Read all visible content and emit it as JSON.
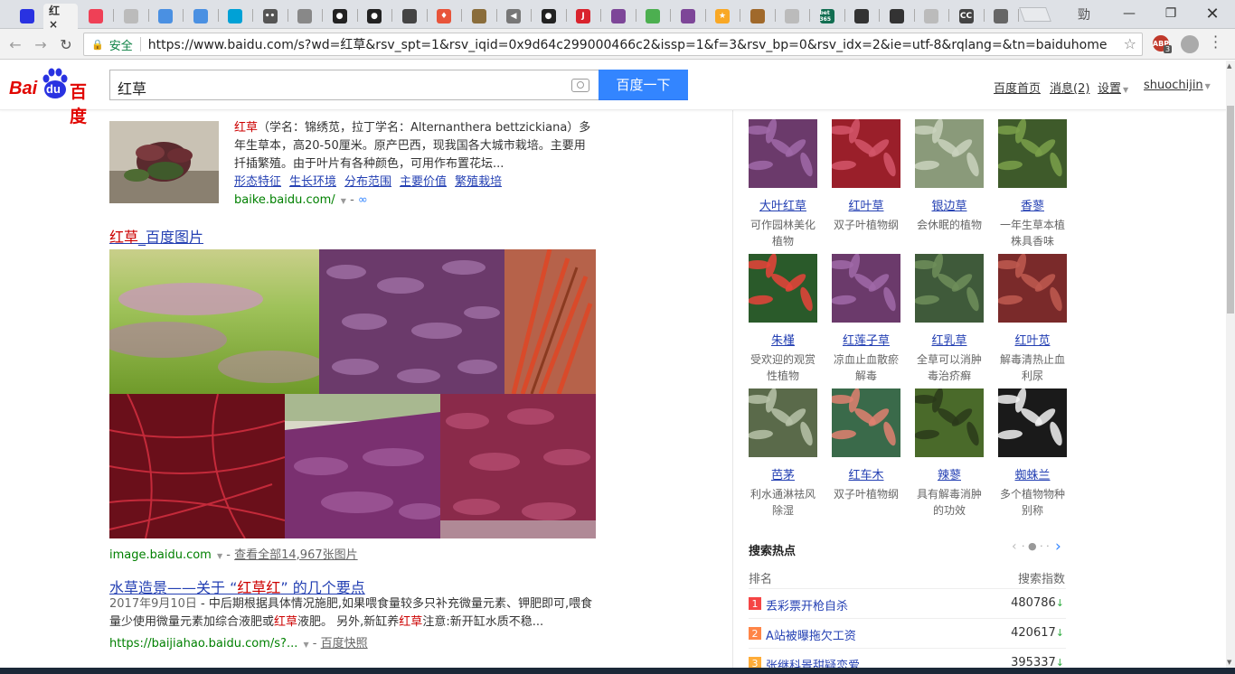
{
  "browser": {
    "secure_label": "安全",
    "url": "https://www.baidu.com/s?wd=红草&rsv_spt=1&rsv_iqid=0x9d64c299000466c2&issp=1&f=3&rsv_bp=0&rsv_idx=2&ie=utf-8&rqlang=&tn=baiduhome_pg&...",
    "active_tab_label": "红",
    "profile_glyph": "勁",
    "abp_label": "ABP",
    "abp_count": "3",
    "tab_icons": [
      "paw-icon",
      "close-icon",
      "pocket-icon",
      "page-icon",
      "rocket-icon",
      "rocket-icon",
      "bilibili-icon",
      "face-icon",
      "robot-icon",
      "github-icon",
      "github-icon",
      "code-icon",
      "fire-icon",
      "plane-icon",
      "media-icon",
      "github-icon",
      "j-icon",
      "tor-icon",
      "chrome-icon",
      "tor-icon",
      "star-icon",
      "lock-icon",
      "page-icon",
      "bet365-icon",
      "board-icon",
      "board-icon",
      "page-icon",
      "cc-icon",
      "browser-icon"
    ],
    "tab_texts": {
      "j-icon": "J",
      "bet365-icon": "bet 365",
      "cc-icon": "CC"
    }
  },
  "header": {
    "logo_bai": "Bai",
    "logo_du": "du",
    "logo_cn": "百度",
    "query": "红草",
    "search_button": "百度一下",
    "links": [
      "百度首页",
      "消息(2)",
      "设置",
      "shuochijin"
    ]
  },
  "results": {
    "baike": {
      "snippet_em": "红草",
      "snippet": "（学名：锦绣苋，拉丁学名：Alternanthera bettzickiana）多年生草本，高20-50厘米。原产巴西，现我国各大城市栽培。主要用扦插繁殖。由于叶片有各种颜色，可用作布置花坛...",
      "sublinks": [
        "形态特征",
        "生长环境",
        "分布范围",
        "主要价值",
        "繁殖栽培"
      ],
      "url": "baike.baidu.com/",
      "url_suffix": "-"
    },
    "images": {
      "title_em": "红草",
      "title_rest": "_百度图片",
      "url": "image.baidu.com",
      "more": "查看全部14,967张图片"
    },
    "article": {
      "title_a": "水草造景——关于 “",
      "title_em": "红草红",
      "title_b": "” 的几个要点",
      "date": "2017年9月10日",
      "snippet_a": " - 中后期根据具体情况施肥,如果喂食量较多只补充微量元素、钾肥即可,喂食量少使用微量元素加综合液肥或",
      "snippet_em1": "红草",
      "snippet_b": "液肥。 另外,新缸养",
      "snippet_em2": "红草",
      "snippet_c": "注意:新开缸水质不稳...",
      "url": "https://baijiahao.baidu.com/s?...",
      "cache": "百度快照"
    }
  },
  "related_plants": [
    {
      "name": "大叶红草",
      "desc": "可作园林美化植物"
    },
    {
      "name": "红叶草",
      "desc": "双子叶植物纲"
    },
    {
      "name": "银边草",
      "desc": "会休眠的植物"
    },
    {
      "name": "香蓼",
      "desc": "一年生草本植株具香味"
    },
    {
      "name": "朱槿",
      "desc": "受欢迎的观赏性植物"
    },
    {
      "name": "红莲子草",
      "desc": "凉血止血散瘀解毒"
    },
    {
      "name": "红乳草",
      "desc": "全草可以消肿毒治疥癣"
    },
    {
      "name": "红叶苋",
      "desc": "解毒清热止血利尿"
    },
    {
      "name": "芭茅",
      "desc": "利水通淋祛风除湿"
    },
    {
      "name": "红车木",
      "desc": "双子叶植物纲"
    },
    {
      "name": "辣蓼",
      "desc": "具有解毒消肿的功效"
    },
    {
      "name": "蜘蛛兰",
      "desc": "多个植物物种别称"
    }
  ],
  "hot": {
    "title": "搜索热点",
    "col_rank": "排名",
    "col_index": "搜索指数",
    "rows": [
      {
        "rank": "1",
        "name": "丢彩票开枪自杀",
        "value": "480786",
        "color": "#f54545"
      },
      {
        "rank": "2",
        "name": "A站被曝拖欠工资",
        "value": "420617",
        "color": "#ff8547"
      },
      {
        "rank": "3",
        "name": "张继科景甜疑恋爱",
        "value": "395337",
        "color": "#ffac38"
      }
    ]
  },
  "colors": {
    "accent": "#3385ff",
    "link": "#2440b3",
    "highlight": "#c00000",
    "url_green": "#008000"
  }
}
